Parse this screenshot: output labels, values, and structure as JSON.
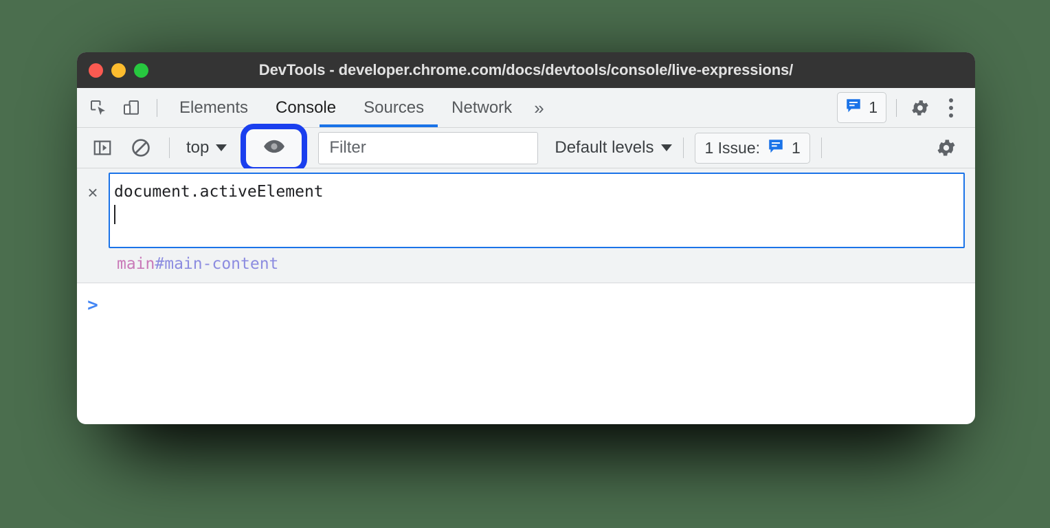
{
  "window": {
    "title": "DevTools - developer.chrome.com/docs/devtools/console/live-expressions/",
    "traffic_lights": [
      {
        "name": "close",
        "color": "#fb5a51"
      },
      {
        "name": "minimize",
        "color": "#fdbc2e"
      },
      {
        "name": "maximize",
        "color": "#27c83f"
      }
    ]
  },
  "tabbar": {
    "icons": [
      {
        "name": "inspect-element-icon"
      },
      {
        "name": "device-toolbar-icon"
      }
    ],
    "tabs": [
      {
        "label": "Elements",
        "active": false
      },
      {
        "label": "Console",
        "active": true
      },
      {
        "label": "Sources",
        "active": false
      },
      {
        "label": "Network",
        "active": false
      }
    ],
    "more_label": "»",
    "message_badge": {
      "icon": "message-bubble-icon",
      "count": "1"
    },
    "settings_icon": "gear-icon",
    "overflow_icon": "more-vertical-icon",
    "active_underline_color": "#1a73e8"
  },
  "console_toolbar": {
    "sidebar_toggle_icon": "console-sidebar-icon",
    "clear_icon": "clear-console-icon",
    "context": {
      "label": "top",
      "caret": "▼"
    },
    "live_expression": {
      "icon": "eye-icon",
      "highlighted": true,
      "highlight_color": "#1a3fee"
    },
    "filter": {
      "placeholder": "Filter",
      "value": ""
    },
    "levels": {
      "label": "Default levels",
      "caret": "▼"
    },
    "issues": {
      "label": "1 Issue:",
      "icon": "message-bubble-icon",
      "count": "1"
    },
    "settings_icon": "gear-icon"
  },
  "live_expression": {
    "close_label": "×",
    "expression": "document.activeElement",
    "caret_line": "",
    "result": {
      "tag": "main",
      "id": "#main-content"
    }
  },
  "console": {
    "prompt_symbol": ">"
  },
  "colors": {
    "background": "#4b6e4e",
    "titlebar": "#343434",
    "toolbar": "#f1f3f4",
    "accent_blue": "#1a73e8",
    "highlight_blue": "#1a3fee",
    "result_tag": "#c979b8",
    "result_id": "#8c8ce0"
  }
}
